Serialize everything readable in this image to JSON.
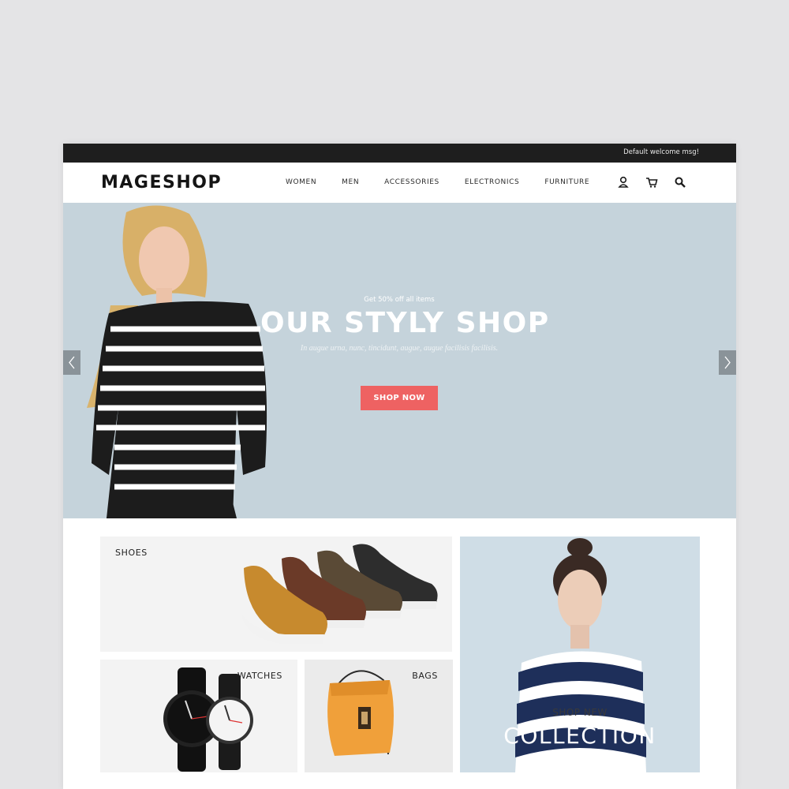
{
  "topbar": {
    "welcome": "Default welcome msg!"
  },
  "header": {
    "logo": "MAGESHOP",
    "nav": [
      "WOMEN",
      "MEN",
      "ACCESSORIES",
      "ELECTRONICS",
      "FURNITURE"
    ],
    "icons": [
      "user-icon",
      "cart-icon",
      "search-icon"
    ]
  },
  "hero": {
    "promo": "Get 50% off all items",
    "title": "OUR STYLY SHOP",
    "subtitle": "In augue urna, nunc, tincidunt, augue, augue facilisis facilisis.",
    "button": "SHOP NOW",
    "background": "#c5d3db",
    "button_color": "#ee6262"
  },
  "categories": {
    "shoes": "SHOES",
    "watches": "WATCHES",
    "bags": "BAGS",
    "collection_small": "SHOP NEW",
    "collection_big": "COLLECTION"
  }
}
